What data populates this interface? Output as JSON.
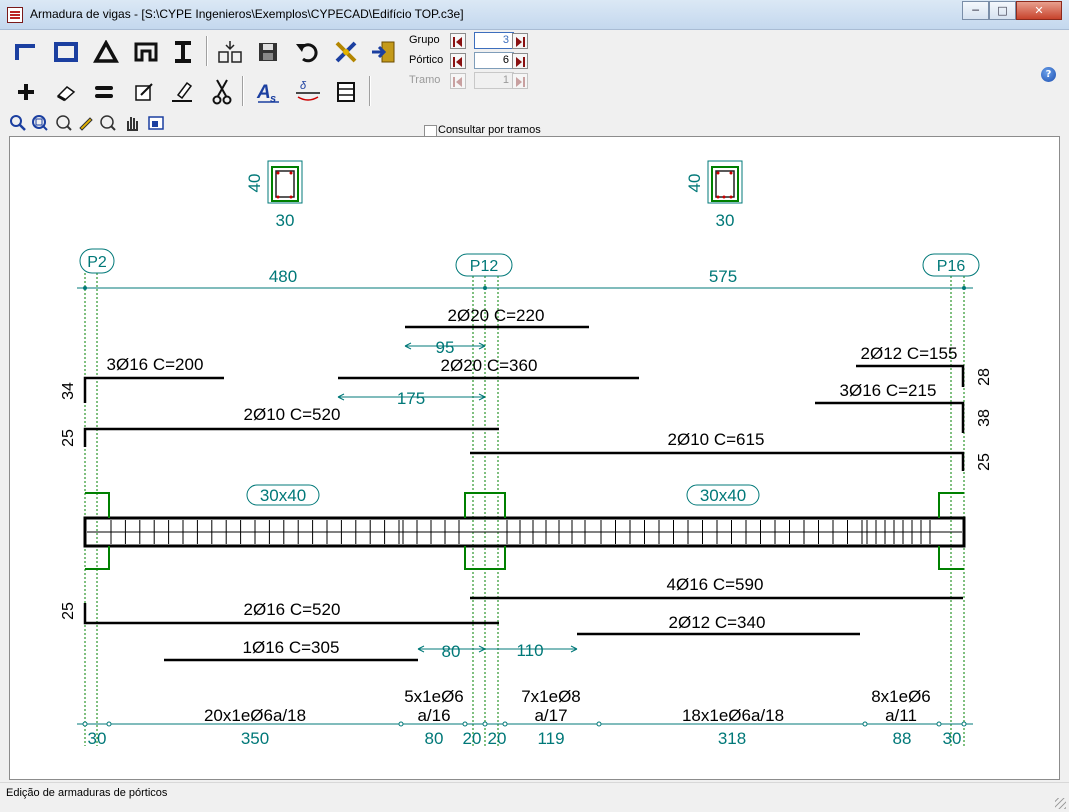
{
  "window": {
    "title": "Armadura de vigas - [S:\\CYPE Ingenieros\\Exemplos\\CYPECAD\\Edifício TOP.c3e]",
    "minimize": "─",
    "maximize": "□",
    "close": "✕"
  },
  "toolbar": {
    "row1_icons": [
      "beam-l-icon",
      "beam-rect-icon",
      "triangle-icon",
      "beam-t-icon",
      "beam-i-icon",
      "merge-icon",
      "save-icon",
      "undo-icon",
      "tools-icon",
      "exit-icon"
    ],
    "row2_icons": [
      "add-icon",
      "eraser-icon",
      "equal-bars-icon",
      "edit-icon",
      "pen-icon",
      "scissors-icon",
      "area-steel-icon",
      "deflection-icon",
      "print-icon"
    ],
    "row3_icons": [
      "zoom-select-icon",
      "zoom-window-icon",
      "zoom-fit-icon",
      "zoom-edit-icon",
      "zoom-in-icon",
      "pan-hand-icon",
      "view-icon"
    ],
    "grupo_label": "Grupo",
    "grupo_value": "3",
    "portico_label": "Pórtico",
    "portico_value": "6",
    "tramo_label": "Tramo",
    "tramo_value": "1",
    "consultar_label": "Consultar por tramos",
    "help": "?"
  },
  "drawing": {
    "section_left": {
      "height": "40",
      "width": "30"
    },
    "section_right": {
      "height": "40",
      "width": "30"
    },
    "columns": [
      "P2",
      "P12",
      "P16"
    ],
    "spans": [
      "480",
      "575"
    ],
    "beam_sizes": [
      "30x40",
      "30x40"
    ],
    "top_bars": [
      {
        "label": "2Ø20 C=220"
      },
      {
        "label": "3Ø16 C=200",
        "hook": "34"
      },
      {
        "label": "2Ø20 C=360"
      },
      {
        "label": "2Ø10 C=520",
        "hook": "25"
      },
      {
        "label": "2Ø12 C=155",
        "hook": "28"
      },
      {
        "label": "3Ø16 C=215",
        "hook": "38"
      },
      {
        "label": "2Ø10 C=615",
        "hook": "25"
      }
    ],
    "top_dims": [
      "95",
      "175"
    ],
    "bottom_bars": [
      {
        "label": "4Ø16 C=590"
      },
      {
        "label": "2Ø16 C=520",
        "hook": "25"
      },
      {
        "label": "2Ø12 C=340"
      },
      {
        "label": "1Ø16 C=305"
      }
    ],
    "bottom_dims": [
      "80",
      "110"
    ],
    "stirrups": [
      {
        "count": "20x1eØ6a/18"
      },
      {
        "count": "5x1eØ6",
        "spacing": "a/16"
      },
      {
        "count": "7x1eØ8",
        "spacing": "a/17"
      },
      {
        "count": "18x1eØ6a/18"
      },
      {
        "count": "8x1eØ6",
        "spacing": "a/11"
      }
    ],
    "stirrup_lengths": [
      "30",
      "350",
      "80",
      "20",
      "20",
      "119",
      "318",
      "88",
      "30"
    ],
    "colors": {
      "dims": "#007878",
      "bars": "#000000",
      "formwork": "#008000"
    }
  },
  "status": {
    "text": "Edição de armaduras de pórticos"
  }
}
